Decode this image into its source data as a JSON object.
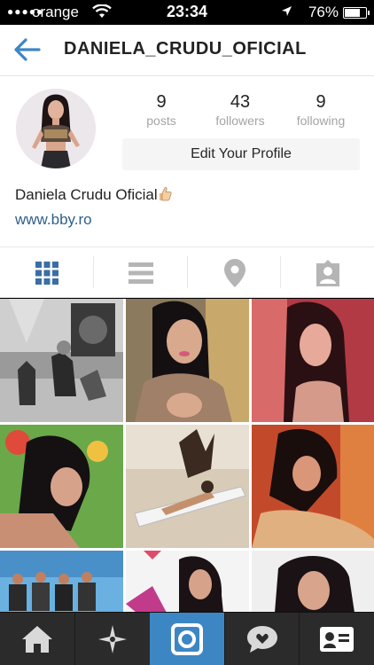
{
  "status_bar": {
    "signal": "●●●●●",
    "carrier": "orange",
    "time": "23:34",
    "battery_percent": "76%",
    "battery_level": 0.76
  },
  "header": {
    "back_icon": "back-arrow-icon",
    "title": "DANIELA_CRUDU_OFICIAL"
  },
  "profile": {
    "stats": [
      {
        "value": "9",
        "label": "posts"
      },
      {
        "value": "43",
        "label": "followers"
      },
      {
        "value": "9",
        "label": "following"
      }
    ],
    "edit_button": "Edit Your Profile",
    "full_name": "Daniela Crudu Oficial",
    "website": "www.bby.ro"
  },
  "view_tabs": [
    {
      "icon": "grid-icon",
      "active": true
    },
    {
      "icon": "list-icon",
      "active": false
    },
    {
      "icon": "location-pin-icon",
      "active": false
    },
    {
      "icon": "tagged-photos-icon",
      "active": false
    }
  ],
  "photos": [
    {
      "name": "photo-1"
    },
    {
      "name": "photo-2"
    },
    {
      "name": "photo-3"
    },
    {
      "name": "photo-4"
    },
    {
      "name": "photo-5"
    },
    {
      "name": "photo-6"
    },
    {
      "name": "photo-7"
    },
    {
      "name": "photo-8"
    },
    {
      "name": "photo-9"
    }
  ],
  "bottom_nav": [
    {
      "icon": "home-icon"
    },
    {
      "icon": "explore-icon"
    },
    {
      "icon": "camera-icon",
      "active": true
    },
    {
      "icon": "activity-icon"
    },
    {
      "icon": "profile-card-icon"
    }
  ],
  "colors": {
    "accent_blue": "#3d86c4",
    "link_blue": "#2f5f8b",
    "active_tab_blue": "#3a6ea5",
    "inactive_tab_gray": "#b5b5b5",
    "nav_bar": "#2b2b2b"
  }
}
